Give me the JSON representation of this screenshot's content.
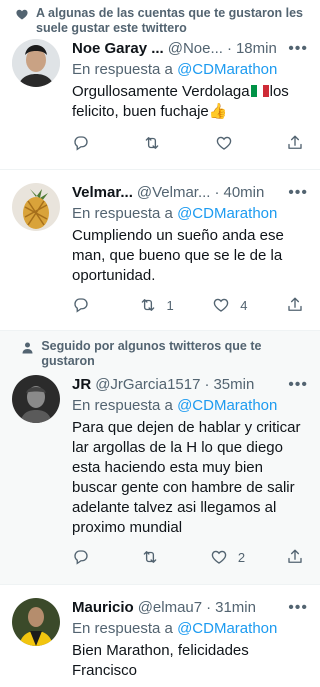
{
  "tweets": [
    {
      "social": "A algunas de las cuentas que te gustaron les suele gustar este twittero",
      "name": "Noe Garay ...",
      "handle": "@Noe...",
      "time": "18min",
      "reply_prefix": "En respuesta a",
      "reply_to": "@CDMarathon",
      "text_1": "Orgullosamente Verdolaga",
      "text_2": "los felicito, buen fuchaje",
      "emoji_thumb": "👍",
      "replies": "",
      "retweets": "",
      "likes": ""
    },
    {
      "name": "Velmar...",
      "handle": "@Velmar...",
      "time": "40min",
      "reply_prefix": "En respuesta a",
      "reply_to": "@CDMarathon",
      "text": "Cumpliendo un sueño anda ese man, que bueno que se le de la oportunidad.",
      "replies": "",
      "retweets": "1",
      "likes": "4"
    },
    {
      "social": "Seguido por algunos twitteros que te gustaron",
      "name": "JR",
      "handle": "@JrGarcia1517",
      "time": "35min",
      "reply_prefix": "En respuesta a",
      "reply_to": "@CDMarathon",
      "text": "Para que dejen de hablar y criticar lar argollas de la H lo que diego esta haciendo esta muy bien buscar gente con hambre de salir adelante talvez asi llegamos al proximo mundial",
      "replies": "",
      "retweets": "",
      "likes": "2"
    },
    {
      "name": "Mauricio",
      "handle": "@elmau7",
      "time": "31min",
      "reply_prefix": "En respuesta a",
      "reply_to": "@CDMarathon",
      "text": "Bien Marathon, felicidades Francisco"
    }
  ],
  "colors": {
    "accent": "#1d9bf0",
    "muted": "#536471",
    "text": "#0f1419",
    "divider": "#eff3f4"
  }
}
